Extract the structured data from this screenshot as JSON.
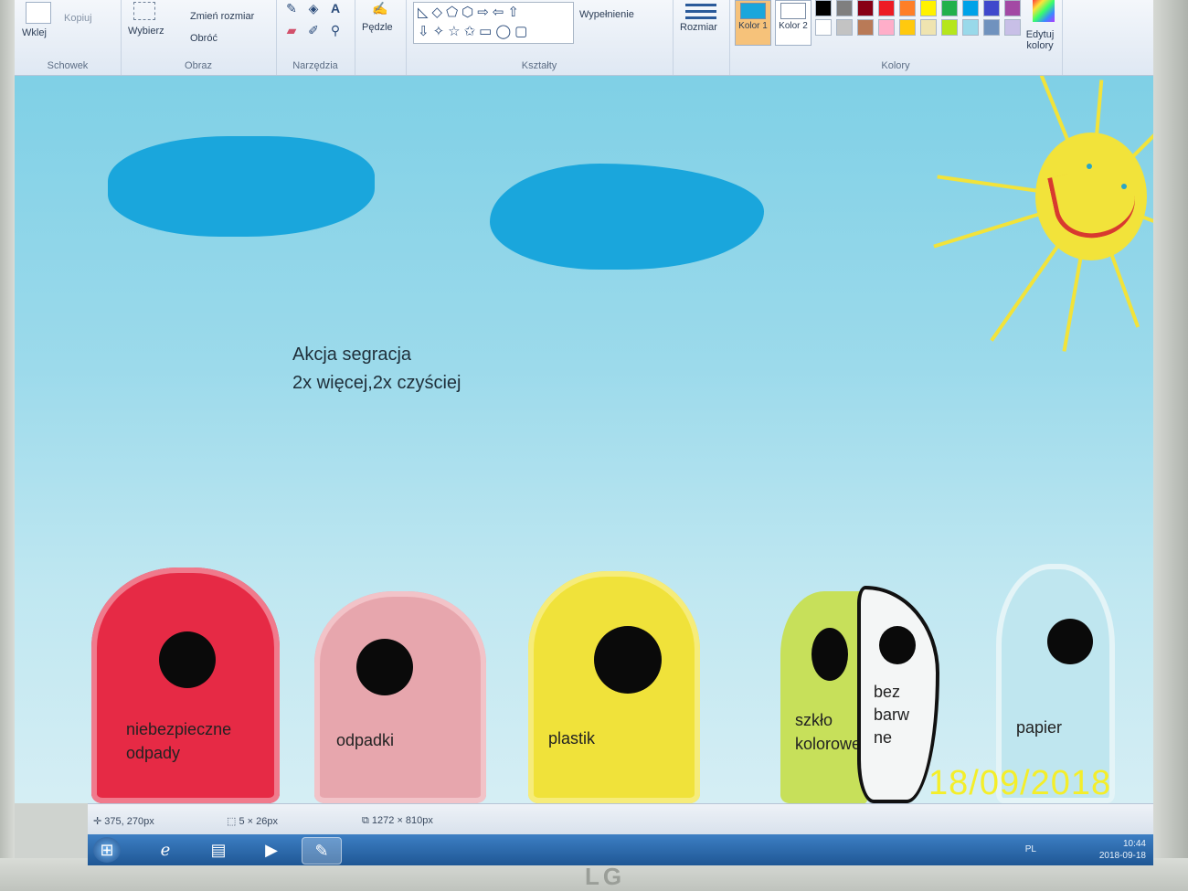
{
  "ribbon": {
    "clipboard": {
      "paste_label": "Wklej",
      "copy_label": "Kopiuj",
      "group_label": "Schowek"
    },
    "image": {
      "select_label": "Wybierz",
      "resize_label": "Zmień rozmiar",
      "rotate_label": "Obróć",
      "group_label": "Obraz"
    },
    "tools": {
      "group_label": "Narzędzia"
    },
    "brushes": {
      "label": "Pędzle"
    },
    "shapes": {
      "fill_label": "Wypełnienie",
      "group_label": "Kształty"
    },
    "size": {
      "label": "Rozmiar"
    },
    "colors": {
      "color1_label": "Kolor 1",
      "color2_label": "Kolor 2",
      "edit_label": "Edytuj kolory",
      "group_label": "Kolory",
      "color1_value": "#1aa6dc",
      "color2_value": "#ffffff",
      "palette": [
        "#000000",
        "#7f7f7f",
        "#880015",
        "#ed1c24",
        "#ff7f27",
        "#fff200",
        "#22b14c",
        "#00a2e8",
        "#3f48cc",
        "#a349a4",
        "#ffffff",
        "#c3c3c3",
        "#b97a57",
        "#ffaec9",
        "#ffc90e",
        "#efe4b0",
        "#b5e61d",
        "#99d9ea",
        "#7092be",
        "#c8bfe7"
      ]
    }
  },
  "canvas": {
    "caption_line1": "Akcja segracja",
    "caption_line2": "2x więcej,2x czyściej",
    "bins": [
      {
        "label_line1": "niebezpieczne",
        "label_line2": "odpady",
        "color": "#e62a45"
      },
      {
        "label_line1": "odpadki",
        "label_line2": "",
        "color": "#e7a6ad"
      },
      {
        "label_line1": "plastik",
        "label_line2": "",
        "color": "#f0e23a"
      },
      {
        "label_line1": "szkło",
        "label_line2": "kolorowe",
        "color": "#c7e05a"
      },
      {
        "label_line1": "bez",
        "label_line2": "barw",
        "label_line3": "ne",
        "color": "#f4f6f6"
      },
      {
        "label_line1": "papier",
        "label_line2": "",
        "color": "#bfe6ef"
      }
    ],
    "cloud_color": "#1aa6dc",
    "sun_color": "#f2e33a"
  },
  "status": {
    "cursor_pos": "375, 270px",
    "selection_size": "5 × 26px",
    "image_size": "1272 × 810px"
  },
  "taskbar": {
    "lang": "PL",
    "time": "10:44",
    "date": "2018-09-18"
  },
  "photo_datestamp": "18/09/2018",
  "monitor_brand": "LG"
}
